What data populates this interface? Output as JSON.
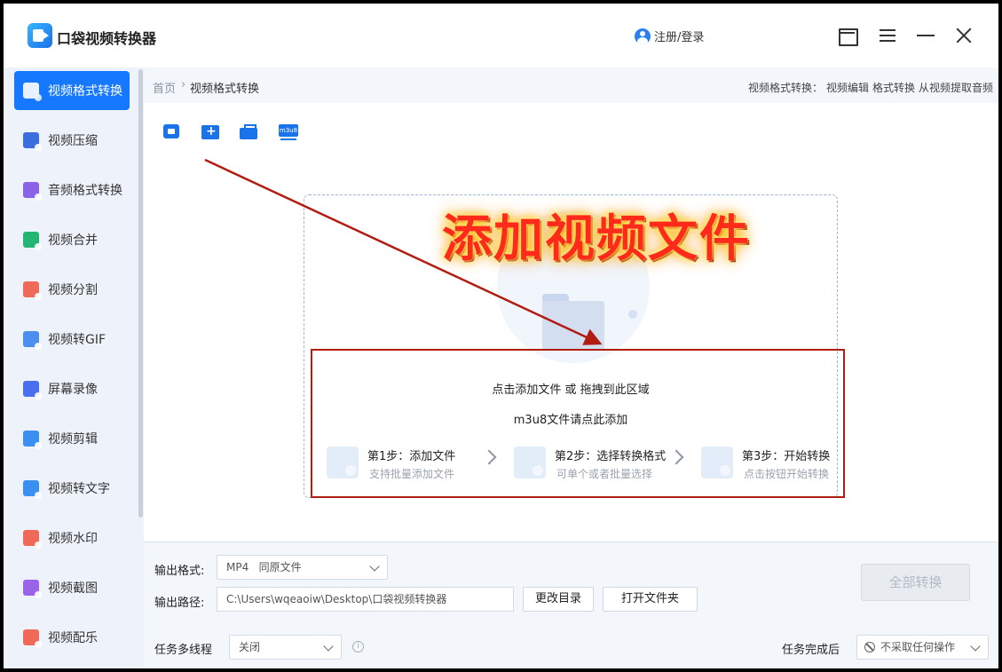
{
  "app": {
    "title": "口袋视频转换器",
    "login_label": "注册/登录"
  },
  "sidebar": {
    "items": [
      {
        "label": "视频格式转换",
        "color": "#ffffff",
        "active": true
      },
      {
        "label": "视频压缩",
        "color": "#3b6fe0"
      },
      {
        "label": "音频格式转换",
        "color": "#8a63e8"
      },
      {
        "label": "视频合并",
        "color": "#22b573"
      },
      {
        "label": "视频分割",
        "color": "#f06a5a"
      },
      {
        "label": "视频转GIF",
        "color": "#4a8ff0"
      },
      {
        "label": "屏幕录像",
        "color": "#4a6ff0"
      },
      {
        "label": "视频剪辑",
        "color": "#3b8ff0"
      },
      {
        "label": "视频转文字",
        "color": "#3b8ff0"
      },
      {
        "label": "视频水印",
        "color": "#f06a5a"
      },
      {
        "label": "视频截图",
        "color": "#9a63e8"
      },
      {
        "label": "视频配乐",
        "color": "#f06a5a"
      }
    ]
  },
  "breadcrumb": {
    "home": "首页",
    "separator": "›",
    "current": "视频格式转换"
  },
  "quick_links": {
    "prefix": "视频格式转换：",
    "links": [
      "视频编辑",
      "格式转换",
      "从视频提取音频"
    ]
  },
  "toolbar": {
    "m3u8_label": "m3u8"
  },
  "dropzone": {
    "hint": "点击添加文件 或 拖拽到此区域",
    "m3u8_hint": "m3u8文件请点此添加",
    "steps": [
      {
        "title": "第1步：添加文件",
        "subtitle": "支持批量添加文件"
      },
      {
        "title": "第2步：选择转换格式",
        "subtitle": "可单个或者批量选择"
      },
      {
        "title": "第3步：开始转换",
        "subtitle": "点击按钮开始转换"
      }
    ]
  },
  "annotation": {
    "text": "添加视频文件",
    "color": "#ff2a1a"
  },
  "bottom": {
    "output_format_label": "输出格式:",
    "output_format_value": "MP4   同原文件",
    "output_path_label": "输出路径:",
    "output_path_value": "C:\\Users\\wqeaoiw\\Desktop\\口袋视频转换器",
    "change_dir_label": "更改目录",
    "open_folder_label": "打开文件夹",
    "convert_all_label": "全部转换",
    "multithread_label": "任务多线程",
    "multithread_value": "关闭",
    "info_glyph": "i",
    "after_complete_label": "任务完成后",
    "after_complete_value": "不采取任何操作"
  }
}
